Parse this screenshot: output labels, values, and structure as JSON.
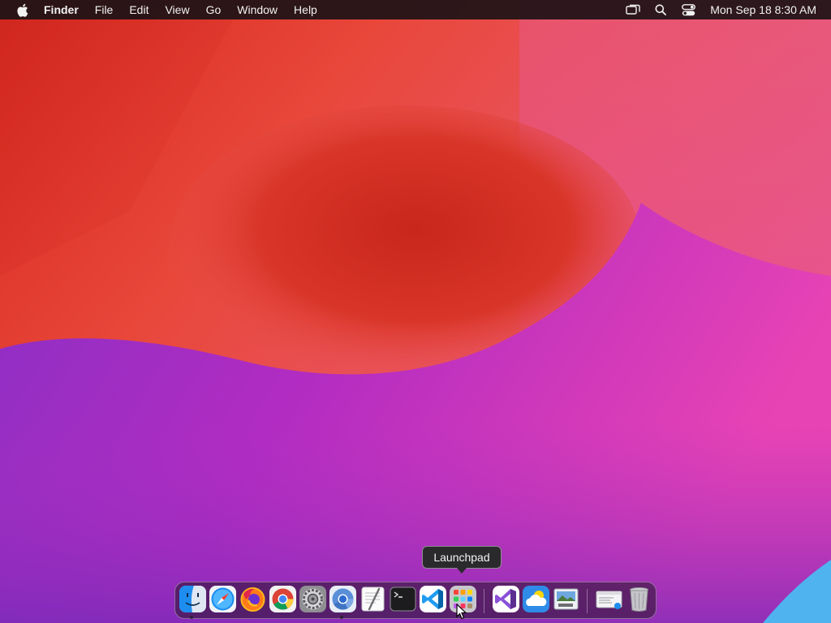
{
  "menubar": {
    "apple_icon": "apple-logo-icon",
    "app_name": "Finder",
    "menus": [
      "File",
      "Edit",
      "View",
      "Go",
      "Window",
      "Help"
    ],
    "status_icons": [
      "screen-mirroring-icon",
      "search-icon",
      "control-center-icon"
    ],
    "clock": "Mon Sep 18  8:30 AM"
  },
  "tooltip": {
    "text": "Launchpad"
  },
  "dock": {
    "apps": [
      {
        "name": "Finder",
        "icon": "finder-icon",
        "running": true
      },
      {
        "name": "Safari",
        "icon": "safari-icon",
        "running": false
      },
      {
        "name": "Firefox",
        "icon": "firefox-icon",
        "running": false
      },
      {
        "name": "Google Chrome",
        "icon": "chrome-icon",
        "running": false
      },
      {
        "name": "System Settings",
        "icon": "gear-icon",
        "running": false
      },
      {
        "name": "Chromium",
        "icon": "chromium-icon",
        "running": true
      },
      {
        "name": "TextEdit",
        "icon": "textedit-icon",
        "running": false
      },
      {
        "name": "Terminal",
        "icon": "terminal-icon",
        "running": false
      },
      {
        "name": "Visual Studio Code",
        "icon": "vscode-icon",
        "running": false
      },
      {
        "name": "Launchpad",
        "icon": "launchpad-icon",
        "running": false
      },
      {
        "name": "Visual Studio",
        "icon": "visual-studio-icon",
        "running": false
      },
      {
        "name": "Weather",
        "icon": "weather-icon",
        "running": false
      },
      {
        "name": "Preview",
        "icon": "preview-icon",
        "running": false
      },
      {
        "name": "Recent Window",
        "icon": "window-thumbnail-icon",
        "running": false
      },
      {
        "name": "Trash",
        "icon": "trash-icon",
        "running": false
      }
    ]
  },
  "colors": {
    "wallpaper_orange": "#e8403a",
    "wallpaper_pink": "#e0409a",
    "wallpaper_purple": "#9a30c8",
    "menubar_bg": "#1c1216",
    "tooltip_bg": "#2a2a2c"
  }
}
